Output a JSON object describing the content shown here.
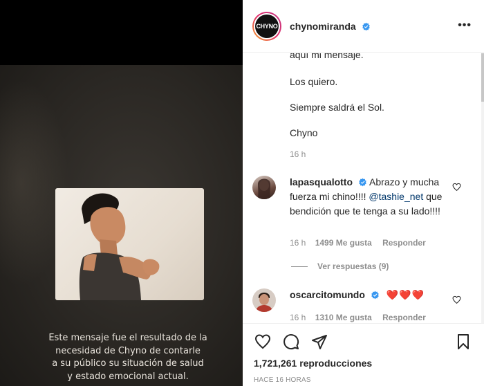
{
  "post": {
    "caption_lines": [
      "Este mensaje fue el resultado de la",
      "necesidad de Chyno de contarle",
      "a su público su situación de salud",
      "y estado emocional actual."
    ]
  },
  "header": {
    "avatar_text": "CHYNO",
    "username": "chynomiranda",
    "more": "•••"
  },
  "owner_caption": {
    "lines": [
      "aquí mi mensaje.",
      "Los quiero.",
      "Siempre saldrá el Sol.",
      "Chyno"
    ],
    "time": "16 h"
  },
  "comments": [
    {
      "username": "lapasqualotto",
      "text_before_mention": "Abrazo y mucha fuerza mi chino!!!!",
      "mention": "@tashie_net",
      "text_after_mention": "que bendición que te tenga a su lado!!!!",
      "time": "16 h",
      "likes": "1499 Me gusta",
      "reply": "Responder",
      "view_replies": "Ver respuestas (9)"
    },
    {
      "username": "oscarcitomundo",
      "hearts": "❤️❤️❤️",
      "time": "16 h",
      "likes": "1310 Me gusta",
      "reply": "Responder"
    }
  ],
  "footer": {
    "views_count": "1,721,261",
    "views_label": "reproducciones",
    "time_ago": "HACE 16 HORAS"
  },
  "colors": {
    "verified": "#3897f0",
    "heart": "#ed4956",
    "muted": "#8e8e8e"
  }
}
